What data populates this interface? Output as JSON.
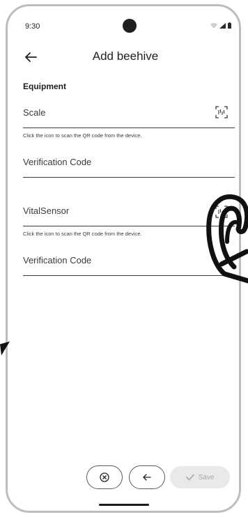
{
  "status_bar": {
    "time": "9:30"
  },
  "app_bar": {
    "title": "Add beehive"
  },
  "form": {
    "section_title": "Equipment",
    "scale_label": "Scale",
    "scale_helper": "Click the icon to scan the QR code from the device.",
    "scale_verification_label": "Verification Code",
    "vital_sensor_label": "VitalSensor",
    "vital_sensor_helper": "Click the icon to scan the QR code from the device.",
    "vital_sensor_verification_label": "Verification Code"
  },
  "actions": {
    "cancel_icon": "cancel-circle-icon",
    "back_icon": "arrow-left-icon",
    "save_label": "Save",
    "save_icon": "check-icon"
  },
  "icons": {
    "scan": "qr-scan-icon",
    "pointer": "hand-pointer-icon"
  },
  "colors": {
    "text": "#1c1b1f",
    "line": "#3b3b3b",
    "save_disabled_bg": "#e9e9e9",
    "save_disabled_text": "#a8a8a8"
  }
}
